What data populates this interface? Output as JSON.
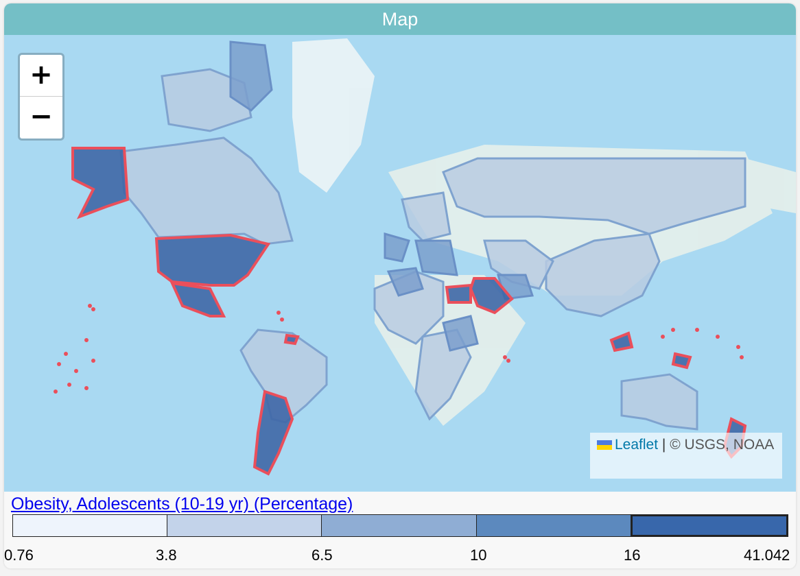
{
  "panel": {
    "title": "Map"
  },
  "zoom": {
    "in_label": "+",
    "out_label": "−"
  },
  "attribution": {
    "leaflet": "Leaflet",
    "separator": "|",
    "copyright": "© USGS, NOAA"
  },
  "legend": {
    "title": "Obesity, Adolescents (10-19 yr) (Percentage)",
    "bins": [
      {
        "color": "#eef4fc"
      },
      {
        "color": "#c3d3ea"
      },
      {
        "color": "#8fadd4"
      },
      {
        "color": "#5c89be"
      },
      {
        "color": "#3867ab",
        "selected": true
      }
    ],
    "ticks": [
      "0.76",
      "3.8",
      "6.5",
      "10",
      "16",
      "41.042"
    ]
  },
  "colors": {
    "ocean": "#a9d9f2",
    "land": "#eef3ea",
    "highlight_stroke": "#ea4f5b",
    "selected_fill": "#3f67a6"
  }
}
